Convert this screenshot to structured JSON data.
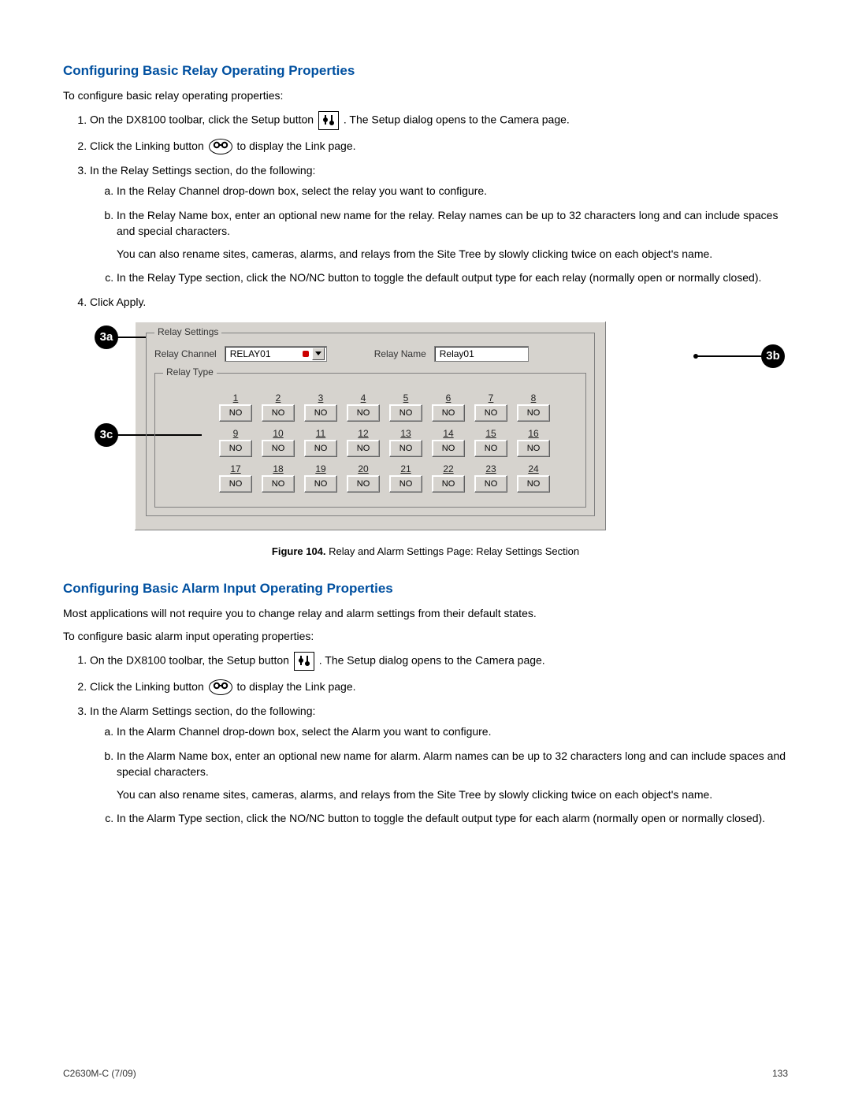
{
  "section1": {
    "title": "Configuring Basic Relay Operating Properties",
    "intro": "To configure basic relay operating properties:",
    "step1_a": "On the DX8100 toolbar, click the Setup button ",
    "step1_b": ". The Setup dialog opens to the Camera page.",
    "step2_a": "Click the Linking button ",
    "step2_b": " to display the Link page.",
    "step3": "In the Relay Settings section, do the following:",
    "sub_a": "In the Relay Channel drop-down box, select the relay you want to configure.",
    "sub_b": "In the Relay Name box, enter an optional new name for the relay. Relay names can be up to 32 characters long and can include spaces and special characters.",
    "sub_b2": "You can also rename sites, cameras, alarms, and relays from the Site Tree by slowly clicking twice on each object's name.",
    "sub_c": "In the Relay Type section, click the NO/NC button to toggle the default output type for each relay (normally open or normally closed).",
    "step4": "Click Apply."
  },
  "figure": {
    "group_main": "Relay Settings",
    "lbl_channel": "Relay Channel",
    "dd_value": "RELAY01",
    "lbl_name": "Relay Name",
    "name_value": "Relay01",
    "group_type": "Relay Type",
    "btn_label": "NO",
    "caption_bold": "Figure 104.",
    "caption_rest": "  Relay and Alarm Settings Page: Relay Settings Section",
    "callout_a": "3a",
    "callout_b": "3b",
    "callout_c": "3c",
    "numbers": [
      "1",
      "2",
      "3",
      "4",
      "5",
      "6",
      "7",
      "8",
      "9",
      "10",
      "11",
      "12",
      "13",
      "14",
      "15",
      "16",
      "17",
      "18",
      "19",
      "20",
      "21",
      "22",
      "23",
      "24"
    ]
  },
  "section2": {
    "title": "Configuring Basic Alarm Input Operating Properties",
    "intro1": "Most applications will not require you to change relay and alarm settings from their default states.",
    "intro2": "To configure basic alarm input operating properties:",
    "step1_a": "On the DX8100 toolbar, the Setup button ",
    "step1_b": ". The Setup dialog opens to the Camera page.",
    "step2_a": "Click the Linking button ",
    "step2_b": " to display the Link page.",
    "step3": "In the Alarm Settings section, do the following:",
    "sub_a": "In the Alarm Channel drop-down box, select the Alarm you want to configure.",
    "sub_b": "In the Alarm Name box, enter an optional new name for alarm. Alarm names can be up to 32 characters long and can include spaces and special characters.",
    "sub_b2": "You can also rename sites, cameras, alarms, and relays from the Site Tree by slowly clicking twice on each object's name.",
    "sub_c": "In the Alarm Type section, click the NO/NC button to toggle the default output type for each alarm (normally open or normally closed)."
  },
  "footer": {
    "left": "C2630M-C (7/09)",
    "right": "133"
  }
}
